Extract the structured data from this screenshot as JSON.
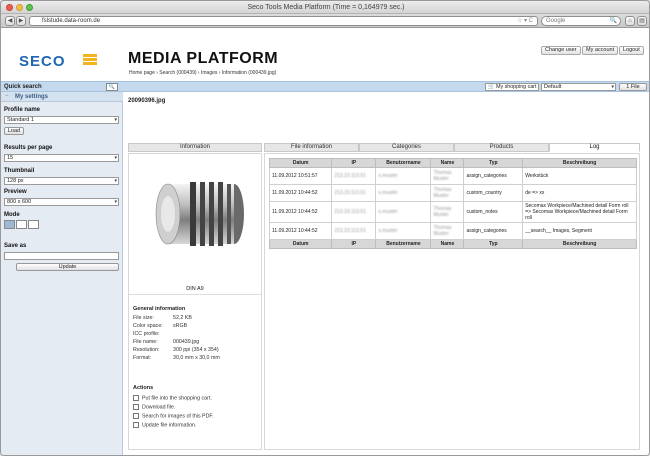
{
  "window": {
    "title": "Seco Tools Media Platform (Time = 0,164979 sec.)"
  },
  "browser": {
    "url": "fslstude.data-room.de",
    "search_placeholder": "Google"
  },
  "header": {
    "logo": "SECO",
    "title": "MEDIA PLATFORM",
    "breadcrumb": "Home page › Search (000439) › Images › Information (000439.jpg)",
    "buttons": [
      "Change user",
      "My account",
      "Logout"
    ]
  },
  "bluebar": {
    "quick_search": "Quick search",
    "my_settings": "My settings",
    "cart_label": "My shopping cart",
    "cart_select": "Default",
    "file_btn": "1 File",
    "file_name": "20090396.jpg"
  },
  "sidebar": {
    "profile_name_label": "Profile name",
    "profile_value": "Standard 1",
    "load_btn": "Load",
    "results_label": "Results per page",
    "results_value": "15",
    "thumbnail_label": "Thumbnail",
    "thumbnail_value": "128 px",
    "preview_label": "Preview",
    "preview_value": "800 x 600",
    "mode_label": "Mode",
    "save_as_label": "Save as",
    "update_btn": "Update"
  },
  "tabs": [
    "Information",
    "File information",
    "Categories",
    "Products",
    "Log"
  ],
  "image": {
    "caption": "DIN A9"
  },
  "general_info": {
    "title": "General information",
    "rows": [
      {
        "k": "File size:",
        "v": "52,2 KB"
      },
      {
        "k": "Color space:",
        "v": "sRGB"
      },
      {
        "k": "ICC profile:",
        "v": ""
      },
      {
        "k": "File name:",
        "v": "000439.jpg"
      },
      {
        "k": "Resolution:",
        "v": "300 ppi (354 x 354)"
      },
      {
        "k": "Format:",
        "v": "30,0 mm x 30,0 mm"
      }
    ]
  },
  "actions": {
    "title": "Actions",
    "items": [
      "Put file into the shopping cart.",
      "Download file.",
      "Search for images of this PDF.",
      "Update file information."
    ]
  },
  "log_table": {
    "headers": [
      "Datum",
      "IP",
      "Benutzername",
      "Name",
      "Typ",
      "Beschreibung"
    ],
    "rows": [
      {
        "datum": "11.09.2012 10:51:57",
        "ip": "213.23.113.51",
        "user": "s.muster",
        "name": "Thomas Muster",
        "typ": "assign_categories",
        "beschreibung": "Werkstück"
      },
      {
        "datum": "11.09.2012 10:44:52",
        "ip": "213.23.113.51",
        "user": "s.muster",
        "name": "Thomas Muster",
        "typ": "custom_country",
        "beschreibung": "de => xx"
      },
      {
        "datum": "11.09.2012 10:44:52",
        "ip": "213.23.113.51",
        "user": "s.muster",
        "name": "Thomas Muster",
        "typ": "custom_notes",
        "beschreibung": "Secomax Workpiece/Machined detail Form roll => Secomax Workpiece/Machined detail Form roll"
      },
      {
        "datum": "11.09.2012 10:44:52",
        "ip": "213.23.113.51",
        "user": "s.muster",
        "name": "Thomas Muster",
        "typ": "assign_categories",
        "beschreibung": "__search__ Images, Segment"
      }
    ]
  },
  "colors": {
    "brand": "#1f67b1",
    "accent_yellow": "#f2b31d",
    "sidebar_bg": "#e4ebf3",
    "bar_blue": "#c4d9ee"
  }
}
